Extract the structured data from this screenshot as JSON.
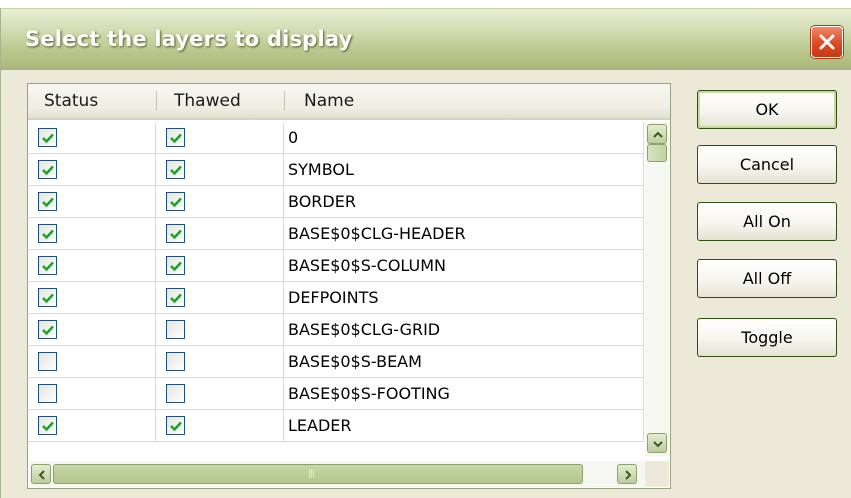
{
  "window": {
    "title": "Select the layers to display"
  },
  "table": {
    "columns": [
      "Status",
      "Thawed",
      "Name"
    ],
    "rows": [
      {
        "status": true,
        "thawed": true,
        "name": "0"
      },
      {
        "status": true,
        "thawed": true,
        "name": "SYMBOL"
      },
      {
        "status": true,
        "thawed": true,
        "name": "BORDER"
      },
      {
        "status": true,
        "thawed": true,
        "name": "BASE$0$CLG-HEADER"
      },
      {
        "status": true,
        "thawed": true,
        "name": "BASE$0$S-COLUMN"
      },
      {
        "status": true,
        "thawed": true,
        "name": "DEFPOINTS"
      },
      {
        "status": true,
        "thawed": false,
        "name": "BASE$0$CLG-GRID"
      },
      {
        "status": false,
        "thawed": false,
        "name": "BASE$0$S-BEAM"
      },
      {
        "status": false,
        "thawed": false,
        "name": "BASE$0$S-FOOTING"
      },
      {
        "status": true,
        "thawed": true,
        "name": "LEADER"
      }
    ]
  },
  "buttons": {
    "ok": "OK",
    "cancel": "Cancel",
    "all_on": "All On",
    "all_off": "All Off",
    "toggle": "Toggle"
  },
  "colors": {
    "titlebar_accent": "#b9c78d",
    "check_color": "#21a121",
    "close_button": "#dd4a23"
  }
}
